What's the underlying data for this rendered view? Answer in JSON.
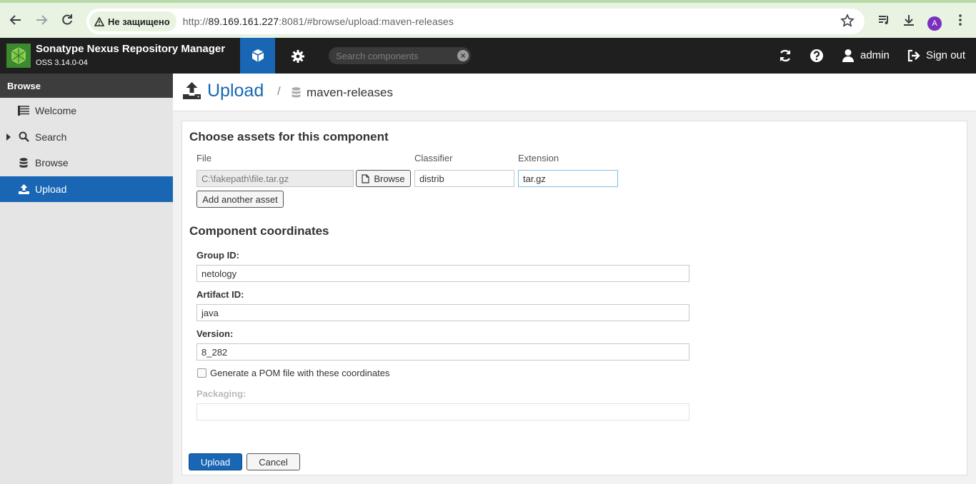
{
  "browser": {
    "security_label": "Не защищено",
    "url_prefix": "http://",
    "url_host": "89.169.161.227",
    "url_rest": ":8081/#browse/upload:maven-releases",
    "profile_initial": "A"
  },
  "header": {
    "app_title": "Sonatype Nexus Repository Manager",
    "app_version": "OSS 3.14.0-04",
    "search_placeholder": "Search components",
    "user": "admin",
    "sign_out": "Sign out"
  },
  "sidebar": {
    "heading": "Browse",
    "items": [
      {
        "label": "Welcome",
        "icon": "list-icon"
      },
      {
        "label": "Search",
        "icon": "search-icon"
      },
      {
        "label": "Browse",
        "icon": "database-icon"
      },
      {
        "label": "Upload",
        "icon": "upload-icon",
        "active": true
      }
    ]
  },
  "breadcrumb": {
    "title": "Upload",
    "separator": "/",
    "repository": "maven-releases"
  },
  "assets": {
    "section_title": "Choose assets for this component",
    "file_label": "File",
    "classifier_label": "Classifier",
    "extension_label": "Extension",
    "file_value": "C:\\fakepath\\file.tar.gz",
    "browse_button": "Browse",
    "classifier_value": "distrib",
    "extension_value": "tar.gz",
    "add_asset_button": "Add another asset"
  },
  "coordinates": {
    "section_title": "Component coordinates",
    "group_label": "Group ID:",
    "group_value": "netology",
    "artifact_label": "Artifact ID:",
    "artifact_value": "java",
    "version_label": "Version:",
    "version_value": "8_282",
    "pom_label": "Generate a POM file with these coordinates",
    "packaging_label": "Packaging:",
    "packaging_value": ""
  },
  "actions": {
    "upload": "Upload",
    "cancel": "Cancel"
  },
  "colors": {
    "accent": "#1866b4",
    "header_bg": "#1f1f1f",
    "sidebar_bg": "#e5e5e5"
  }
}
